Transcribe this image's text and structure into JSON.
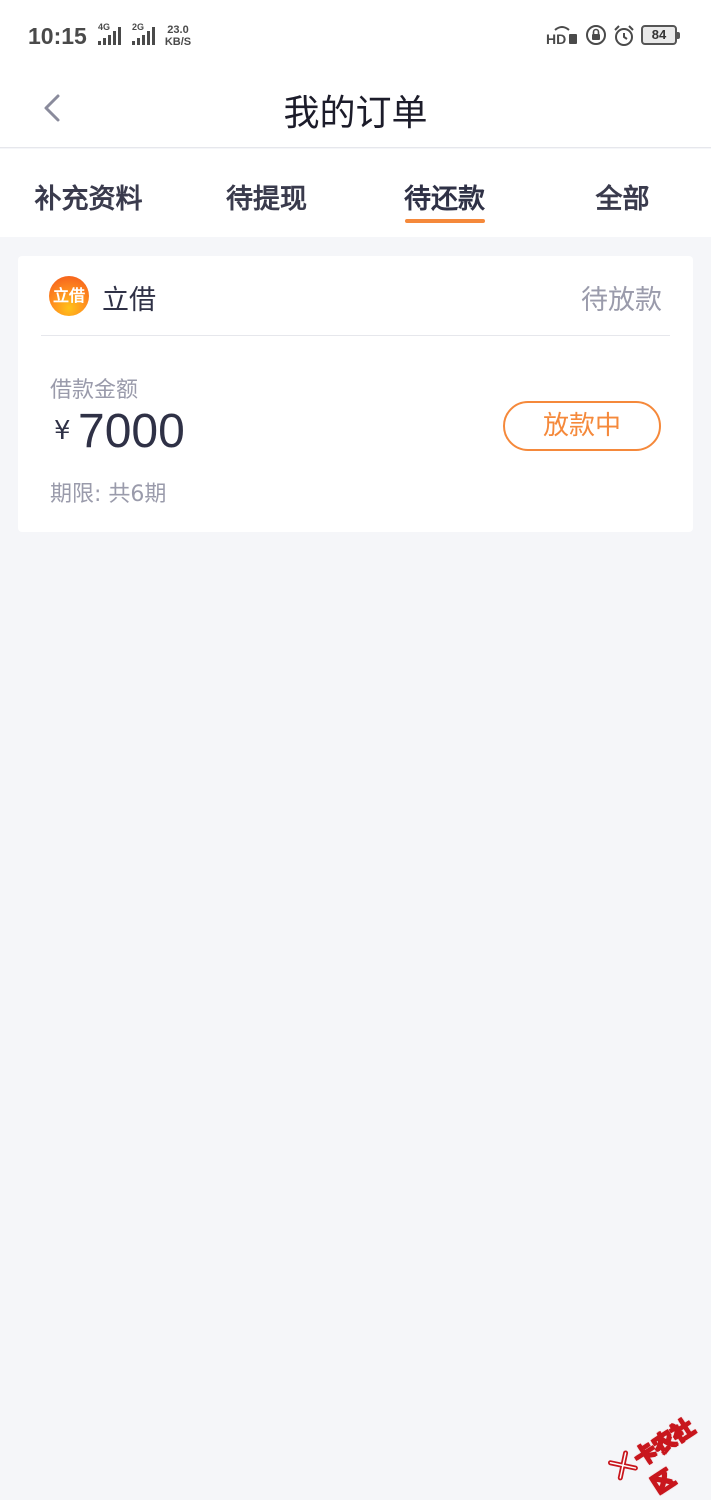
{
  "status_bar": {
    "time": "10:15",
    "signal_1_label": "4G",
    "signal_2_label": "2G",
    "net_speed_value": "23.0",
    "net_speed_unit": "KB/S",
    "battery_level": "84",
    "icons": [
      "hd-icon",
      "rotation-lock-icon",
      "alarm-icon",
      "battery-icon"
    ]
  },
  "header": {
    "title": "我的订单",
    "back_icon": "chevron-left-icon"
  },
  "tabs": [
    {
      "label": "补充资料",
      "active": false
    },
    {
      "label": "待提现",
      "active": false
    },
    {
      "label": "待还款",
      "active": true
    },
    {
      "label": "全部",
      "active": false
    }
  ],
  "order": {
    "lender_logo_text": "立借",
    "lender_name": "立借",
    "status": "待放款",
    "amount_label": "借款金额",
    "currency_symbol": "¥",
    "amount": "7000",
    "term": "期限: 共6期",
    "action_label": "放款中"
  },
  "watermark": {
    "text": "卡农社区"
  },
  "colors": {
    "accent": "#f5893b",
    "background": "#f5f6f9",
    "text_primary": "#2f3146",
    "text_secondary": "#9a9bab"
  }
}
